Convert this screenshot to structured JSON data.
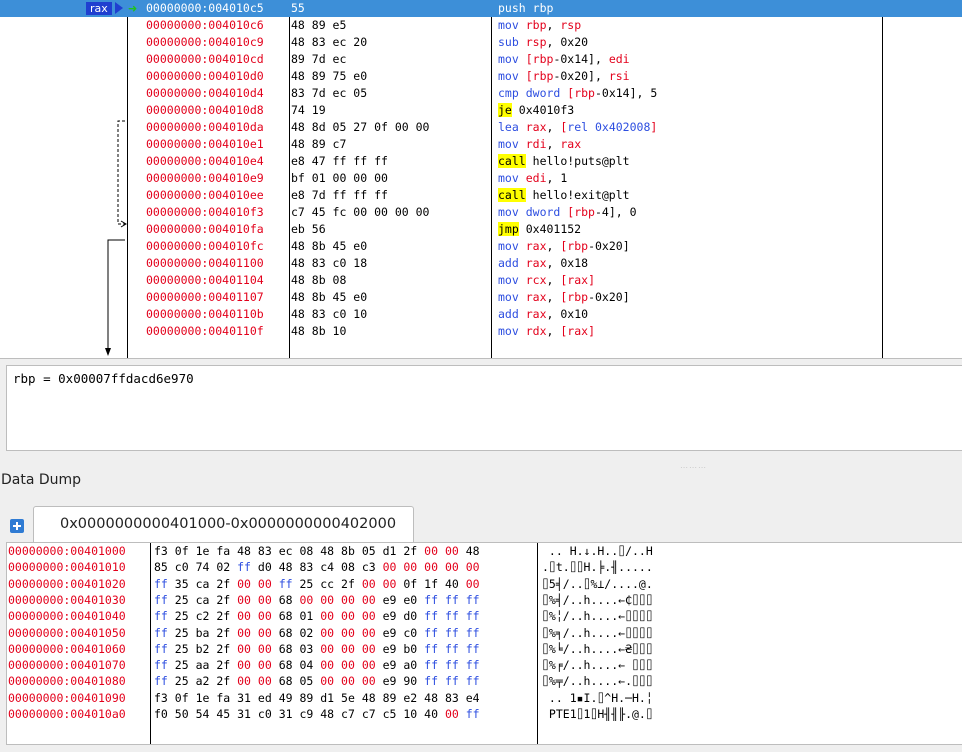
{
  "disasm": {
    "rax_label": "rax",
    "rows": [
      {
        "addr": "00000000:004010c5",
        "bytes": "55",
        "mnemonic": "push",
        "operands": [
          [
            "rbp",
            "reg"
          ]
        ],
        "selected": true
      },
      {
        "addr": "00000000:004010c6",
        "bytes": "48 89 e5",
        "mnemonic": "mov",
        "operands": [
          [
            "rbp",
            "reg"
          ],
          [
            ", ",
            ""
          ],
          [
            "rsp",
            "reg"
          ]
        ]
      },
      {
        "addr": "00000000:004010c9",
        "bytes": "48 83 ec 20",
        "mnemonic": "sub",
        "operands": [
          [
            "rsp",
            "reg"
          ],
          [
            ", 0x20",
            ""
          ]
        ]
      },
      {
        "addr": "00000000:004010cd",
        "bytes": "89 7d ec",
        "mnemonic": "mov",
        "operands": [
          [
            "[",
            "reg"
          ],
          [
            "rbp",
            "reg"
          ],
          [
            "-0x14], ",
            ""
          ],
          [
            "edi",
            "reg"
          ]
        ]
      },
      {
        "addr": "00000000:004010d0",
        "bytes": "48 89 75 e0",
        "mnemonic": "mov",
        "operands": [
          [
            "[",
            "reg"
          ],
          [
            "rbp",
            "reg"
          ],
          [
            "-0x20], ",
            ""
          ],
          [
            "rsi",
            "reg"
          ]
        ]
      },
      {
        "addr": "00000000:004010d4",
        "bytes": "83 7d ec 05",
        "mnemonic": "cmp",
        "operands": [
          [
            "dword ",
            "mn"
          ],
          [
            "[",
            "reg"
          ],
          [
            "rbp",
            "reg"
          ],
          [
            "-0x14], 5",
            ""
          ]
        ]
      },
      {
        "addr": "00000000:004010d8",
        "bytes": "74 19",
        "mnemonic": "je",
        "hl": true,
        "operands": [
          [
            "0x4010f3",
            ""
          ]
        ]
      },
      {
        "addr": "00000000:004010da",
        "bytes": "48 8d 05 27 0f 00 00",
        "mnemonic": "lea",
        "operands": [
          [
            "rax",
            "reg"
          ],
          [
            ", ",
            ""
          ],
          [
            "[",
            "reg"
          ],
          [
            "rel 0x402008",
            "mn"
          ],
          [
            "]",
            "reg"
          ]
        ]
      },
      {
        "addr": "00000000:004010e1",
        "bytes": "48 89 c7",
        "mnemonic": "mov",
        "operands": [
          [
            "rdi",
            "reg"
          ],
          [
            ", ",
            ""
          ],
          [
            "rax",
            "reg"
          ]
        ]
      },
      {
        "addr": "00000000:004010e4",
        "bytes": "e8 47 ff ff ff",
        "mnemonic": "call",
        "hl": true,
        "operands": [
          [
            "hello!puts@plt",
            ""
          ]
        ]
      },
      {
        "addr": "00000000:004010e9",
        "bytes": "bf 01 00 00 00",
        "mnemonic": "mov",
        "operands": [
          [
            "edi",
            "reg"
          ],
          [
            ", 1",
            ""
          ]
        ]
      },
      {
        "addr": "00000000:004010ee",
        "bytes": "e8 7d ff ff ff",
        "mnemonic": "call",
        "hl": true,
        "operands": [
          [
            "hello!exit@plt",
            ""
          ]
        ]
      },
      {
        "addr": "00000000:004010f3",
        "bytes": "c7 45 fc 00 00 00 00",
        "mnemonic": "mov",
        "operands": [
          [
            "dword ",
            "mn"
          ],
          [
            "[",
            "reg"
          ],
          [
            "rbp",
            "reg"
          ],
          [
            "-4], 0",
            ""
          ]
        ]
      },
      {
        "addr": "00000000:004010fa",
        "bytes": "eb 56",
        "mnemonic": "jmp",
        "hl": true,
        "operands": [
          [
            "0x401152",
            ""
          ]
        ]
      },
      {
        "addr": "00000000:004010fc",
        "bytes": "48 8b 45 e0",
        "mnemonic": "mov",
        "operands": [
          [
            "rax",
            "reg"
          ],
          [
            ", ",
            ""
          ],
          [
            "[",
            "reg"
          ],
          [
            "rbp",
            "reg"
          ],
          [
            "-0x20]",
            ""
          ]
        ]
      },
      {
        "addr": "00000000:00401100",
        "bytes": "48 83 c0 18",
        "mnemonic": "add",
        "operands": [
          [
            "rax",
            "reg"
          ],
          [
            ", 0x18",
            ""
          ]
        ]
      },
      {
        "addr": "00000000:00401104",
        "bytes": "48 8b 08",
        "mnemonic": "mov",
        "operands": [
          [
            "rcx",
            "reg"
          ],
          [
            ", ",
            ""
          ],
          [
            "[",
            "reg"
          ],
          [
            "rax",
            "reg"
          ],
          [
            "]",
            "reg"
          ]
        ]
      },
      {
        "addr": "00000000:00401107",
        "bytes": "48 8b 45 e0",
        "mnemonic": "mov",
        "operands": [
          [
            "rax",
            "reg"
          ],
          [
            ", ",
            ""
          ],
          [
            "[",
            "reg"
          ],
          [
            "rbp",
            "reg"
          ],
          [
            "-0x20]",
            ""
          ]
        ]
      },
      {
        "addr": "00000000:0040110b",
        "bytes": "48 83 c0 10",
        "mnemonic": "add",
        "operands": [
          [
            "rax",
            "reg"
          ],
          [
            ", 0x10",
            ""
          ]
        ]
      },
      {
        "addr": "00000000:0040110f",
        "bytes": "48 8b 10",
        "mnemonic": "mov",
        "operands": [
          [
            "rdx",
            "reg"
          ],
          [
            ", ",
            ""
          ],
          [
            "[",
            "reg"
          ],
          [
            "rax",
            "reg"
          ],
          [
            "]",
            "reg"
          ]
        ]
      }
    ]
  },
  "info": {
    "text": "rbp = 0x00007ffdacd6e970"
  },
  "dump": {
    "title": "Data Dump",
    "tab_label": "0x0000000000401000-0x0000000000402000",
    "rows": [
      {
        "addr": "00000000:00401000",
        "bytes": [
          "f3",
          "0f",
          "1e",
          "fa",
          "48",
          "83",
          "ec",
          "08",
          "48",
          "8b",
          "05",
          "d1",
          "2f",
          "00",
          "00",
          "48"
        ],
        "ascii": " .. H.↓.H..⌷/..H"
      },
      {
        "addr": "00000000:00401010",
        "bytes": [
          "85",
          "c0",
          "74",
          "02",
          "ff",
          "d0",
          "48",
          "83",
          "c4",
          "08",
          "c3",
          "00",
          "00",
          "00",
          "00",
          "00"
        ],
        "ascii": ".⌷t.⌷⌷H.╞.╢....."
      },
      {
        "addr": "00000000:00401020",
        "bytes": [
          "ff",
          "35",
          "ca",
          "2f",
          "00",
          "00",
          "ff",
          "25",
          "cc",
          "2f",
          "00",
          "00",
          "0f",
          "1f",
          "40",
          "00"
        ],
        "ascii": "⌷5╡/..⌷%⊥/....@."
      },
      {
        "addr": "00000000:00401030",
        "bytes": [
          "ff",
          "25",
          "ca",
          "2f",
          "00",
          "00",
          "68",
          "00",
          "00",
          "00",
          "00",
          "e9",
          "e0",
          "ff",
          "ff",
          "ff"
        ],
        "ascii": "⌷%╡/..h....←₵⌷⌷⌷"
      },
      {
        "addr": "00000000:00401040",
        "bytes": [
          "ff",
          "25",
          "c2",
          "2f",
          "00",
          "00",
          "68",
          "01",
          "00",
          "00",
          "00",
          "e9",
          "d0",
          "ff",
          "ff",
          "ff"
        ],
        "ascii": "⌷%╎/..h....←⌷⌷⌷⌷"
      },
      {
        "addr": "00000000:00401050",
        "bytes": [
          "ff",
          "25",
          "ba",
          "2f",
          "00",
          "00",
          "68",
          "02",
          "00",
          "00",
          "00",
          "e9",
          "c0",
          "ff",
          "ff",
          "ff"
        ],
        "ascii": "⌷%╕/..h....←⌷⌷⌷⌷"
      },
      {
        "addr": "00000000:00401060",
        "bytes": [
          "ff",
          "25",
          "b2",
          "2f",
          "00",
          "00",
          "68",
          "03",
          "00",
          "00",
          "00",
          "e9",
          "b0",
          "ff",
          "ff",
          "ff"
        ],
        "ascii": "⌷%╘/..h....←₴⌷⌷⌷"
      },
      {
        "addr": "00000000:00401070",
        "bytes": [
          "ff",
          "25",
          "aa",
          "2f",
          "00",
          "00",
          "68",
          "04",
          "00",
          "00",
          "00",
          "e9",
          "a0",
          "ff",
          "ff",
          "ff"
        ],
        "ascii": "⌷%╒/..h....← ⌷⌷⌷"
      },
      {
        "addr": "00000000:00401080",
        "bytes": [
          "ff",
          "25",
          "a2",
          "2f",
          "00",
          "00",
          "68",
          "05",
          "00",
          "00",
          "00",
          "e9",
          "90",
          "ff",
          "ff",
          "ff"
        ],
        "ascii": "⌷%╤/..h....←.⌷⌷⌷"
      },
      {
        "addr": "00000000:00401090",
        "bytes": [
          "f3",
          "0f",
          "1e",
          "fa",
          "31",
          "ed",
          "49",
          "89",
          "d1",
          "5e",
          "48",
          "89",
          "e2",
          "48",
          "83",
          "e4"
        ],
        "ascii": " .. 1▪I.⌷^H.─H.╎"
      },
      {
        "addr": "00000000:004010a0",
        "bytes": [
          "f0",
          "50",
          "54",
          "45",
          "31",
          "c0",
          "31",
          "c9",
          "48",
          "c7",
          "c7",
          "c5",
          "10",
          "40",
          "00",
          "ff"
        ],
        "ascii": " PTE1⌷1⌷H╢╢╟.@.⌷"
      }
    ]
  },
  "colors": {
    "selected_row": "#3d8fd8",
    "address": "#e3001b",
    "register": "#e3001b",
    "mnemonic": "#2d4ee0",
    "highlight": "#ffff00",
    "rax_badge": "#1f3fd0"
  }
}
